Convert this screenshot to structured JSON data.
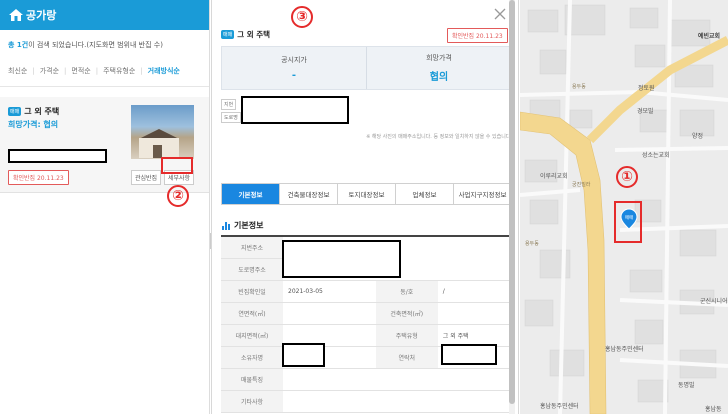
{
  "app": {
    "logo_text": "공가랑"
  },
  "list": {
    "result_count": "총 1건",
    "result_rest": "이 검색 되었습니다.(지도화면 범위내 반집 수)",
    "sort_options": [
      "최신순",
      "가격순",
      "면적순",
      "주택유형순",
      "거래방식순"
    ],
    "card": {
      "tag": "매매",
      "title": "그 외 주택",
      "price": "희망가격: 협의",
      "confirm_badge": "확인반집 20.11.23",
      "interest_label": "관심반집",
      "detail_label": "세부사항"
    }
  },
  "detail": {
    "tag": "매매",
    "title": "그 외 주택",
    "confirm_badge": "확인반집 20.11.23",
    "price_boxes": [
      {
        "label": "공시지가",
        "value": "-"
      },
      {
        "label": "희망가격",
        "value": "협의"
      }
    ],
    "addr_tags": [
      "지번",
      "도로명"
    ],
    "notice": "※ 해당 사진의 매매주소입니다. 등 정보와 일치하지 않을 수 있습니다.",
    "tabs": [
      "기본정보",
      "건축물대장정보",
      "토지대장정보",
      "업체정보",
      "사업지구지정정보"
    ],
    "section_title": "기본정보",
    "table": {
      "jibun_addr": "지번주소",
      "road_addr": "도로명주소",
      "confirm_date_label": "빈집확인일",
      "confirm_date": "2021-03-05",
      "dong_label": "동/호",
      "dong_value": "/",
      "floor_area_label": "연면적(㎡)",
      "build_area_label": "건축면적(㎡)",
      "land_area_label": "대지면적(㎡)",
      "house_type_label": "주택유형",
      "house_type_value": "그 외 주택",
      "owner_label": "소유자명",
      "contact_label": "연락처",
      "features_label": "매물특징",
      "etc_label": "기타사항"
    }
  },
  "annotations": {
    "one": "①",
    "two": "②",
    "three": "③"
  },
  "map": {
    "labels": [
      "예빈교회",
      "정토원",
      "경모빌",
      "용두동",
      "양정",
      "성소는교회",
      "이루리교회",
      "궁진밀라",
      "용두동",
      "군신시니어클럽",
      "홍남동주민센터",
      "동명빌",
      "홍남동주민센터",
      "홍남동"
    ],
    "pin_label": "매매"
  },
  "colors": {
    "brand": "#1a9bd7",
    "tab_active": "#1a87e0",
    "annotation": "#e52b2b",
    "road": "#f3d78f"
  }
}
